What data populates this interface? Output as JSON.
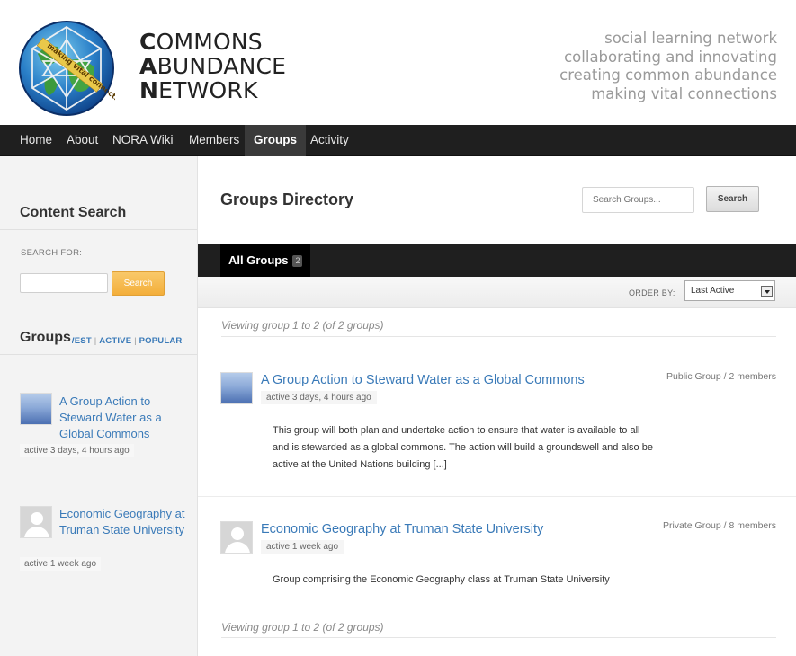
{
  "site": {
    "logo_lines": [
      {
        "first": "C",
        "rest": "OMMONS"
      },
      {
        "first": "A",
        "rest": "BUNDANCE"
      },
      {
        "first": "N",
        "rest": "ETWORK"
      }
    ],
    "logo_globe_text": "making vital connections",
    "tagline": [
      "social learning network",
      "collaborating and innovating",
      "creating common abundance",
      "making vital connections"
    ]
  },
  "nav": {
    "items": [
      "Home",
      "About",
      "NORA Wiki",
      "Members",
      "Groups",
      "Activity"
    ],
    "active": "Groups"
  },
  "sidebar": {
    "content_search_title": "Content Search",
    "search_for_label": "SEARCH FOR:",
    "search_button": "Search",
    "groups_title": "Groups",
    "filters": [
      "NEWEST",
      "ACTIVE",
      "POPULAR"
    ],
    "groups": [
      {
        "name": "A Group Action to Steward Water as a Global Commons",
        "meta": "active 3 days, 4 hours ago",
        "avatar": "water"
      },
      {
        "name": "Economic Geography at Truman State University",
        "meta": "active 1 week ago",
        "avatar": "default"
      }
    ]
  },
  "main": {
    "title": "Groups Directory",
    "search_placeholder": "Search Groups...",
    "search_button": "Search",
    "tab_label": "All Groups",
    "tab_count": "2",
    "order_by_label": "ORDER BY:",
    "order_by_value": "Last Active",
    "viewing_text": "Viewing group 1 to 2 (of 2 groups)",
    "groups": [
      {
        "name": "A Group Action to Steward Water as a Global Commons",
        "type": "Public Group / 2 members",
        "active": "active 3 days, 4 hours ago",
        "description": "This group will both plan and undertake action to ensure that water is available to all and is stewarded as a global commons. The action will build a groundswell and also be active at the United Nations building [...]"
      },
      {
        "name": "Economic Geography at Truman State University",
        "type": "Private Group / 8 members",
        "active": "active 1 week ago",
        "description": "Group comprising the Economic Geography class at Truman State University"
      }
    ]
  },
  "colors": {
    "link": "#3a7ab8",
    "nav_bg": "#1f1f1f",
    "accent_button": "#f3ae3a"
  }
}
